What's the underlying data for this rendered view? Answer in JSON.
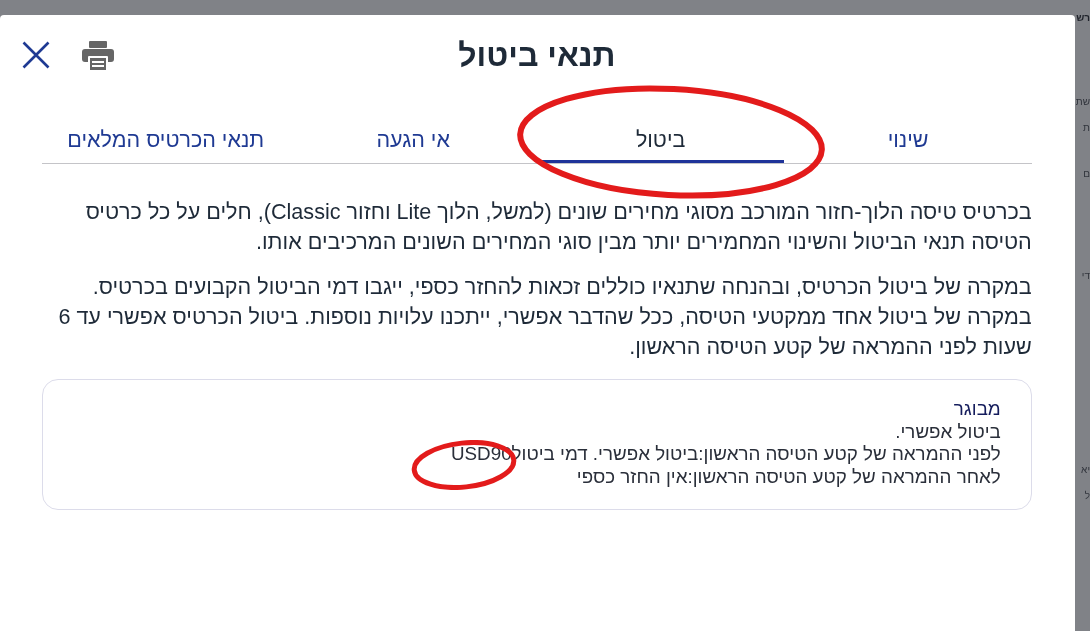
{
  "dialog": {
    "title": "תנאי ביטול",
    "tabs": [
      {
        "label": "שינוי",
        "selected": false,
        "circled": false
      },
      {
        "label": "ביטול",
        "selected": true,
        "circled": true
      },
      {
        "label": "אי הגעה",
        "selected": false,
        "circled": false
      },
      {
        "label": "תנאי הכרטיס המלאים",
        "selected": false,
        "circled": false
      }
    ],
    "paragraphs": [
      {
        "sentences": [
          "בכרטיס טיסה הלוך-חזור המורכב מסוגי מחירים שונים (למשל, הלוך Lite וחזור Classic), חלים על כל כרטיס הטיסה תנאי הביטול והשינוי המחמירים יותר מבין סוגי המחירים השונים המרכיבים אותו."
        ]
      },
      {
        "sentences": [
          "במקרה של ביטול הכרטיס, ובהנחה שתנאיו כוללים זכאות להחזר כספי, ייגבו דמי הביטול הקבועים בכרטיס.",
          "במקרה של ביטול אחד ממקטעי הטיסה, ככל שהדבר אפשרי, ייתכנו עלויות נוספות. ביטול הכרטיס אפשרי עד 6 שעות לפני ההמראה של קטע הטיסה הראשון."
        ]
      }
    ],
    "fare_box": {
      "passenger_type": "מבוגר",
      "lines": [
        {
          "text": "ביטול אפשרי."
        },
        {
          "text": "לפני ההמראה של קטע הטיסה הראשון:ביטול אפשרי. דמי ביטול",
          "amount": "USD90",
          "amount_circled": true
        },
        {
          "text": "לאחר ההמראה של קטע הטיסה הראשון:אין החזר כספי"
        }
      ]
    }
  },
  "background_page": {
    "fragments": [
      {
        "text": "רש",
        "kind": "heading"
      },
      {
        "text": "שת",
        "kind": "text"
      },
      {
        "text": "ת",
        "kind": "text"
      },
      {
        "text": "ם",
        "kind": "text"
      },
      {
        "text": "די",
        "kind": "text"
      },
      {
        "text": "יא",
        "kind": "text"
      },
      {
        "text": "ל",
        "kind": "text"
      }
    ]
  }
}
